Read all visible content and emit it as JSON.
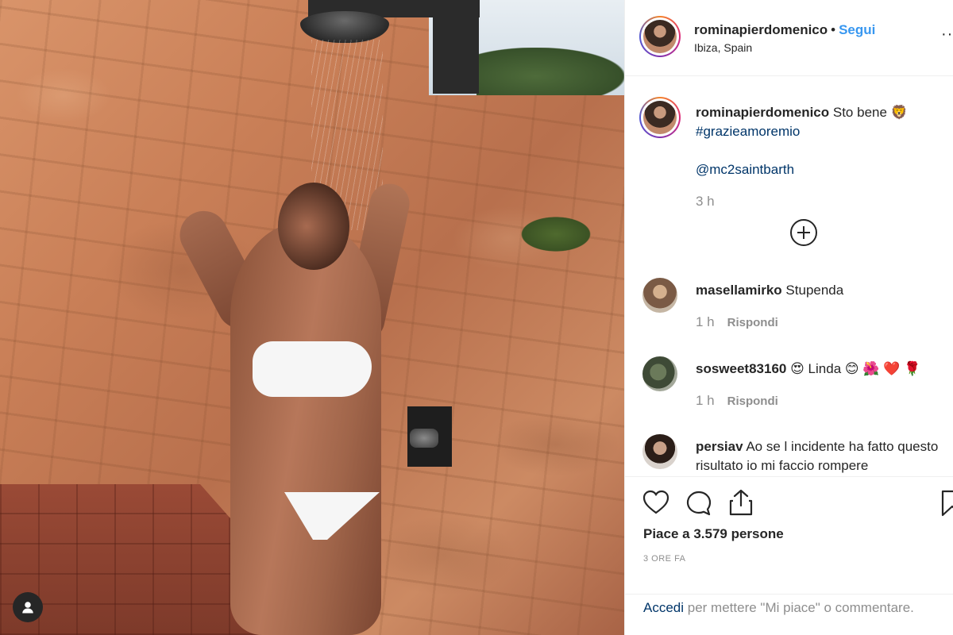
{
  "post": {
    "username": "rominapierdomenico",
    "separator": "•",
    "follow_label": "Segui",
    "location": "Ibiza, Spain",
    "more_label": "···"
  },
  "caption": {
    "username": "rominapierdomenico",
    "text": "Sto bene 🦁",
    "hashtag": "#grazieamoremio",
    "mention": "@mc2saintbarth",
    "time": "3 h"
  },
  "comments": [
    {
      "username": "masellamirko",
      "text": "Stupenda",
      "time": "1 h",
      "reply_label": "Rispondi"
    },
    {
      "username": "sosweet83160",
      "text": "😍 Linda 😊 🌺 ❤️ 🌹",
      "time": "1 h",
      "reply_label": "Rispondi"
    },
    {
      "username": "persiav",
      "text": "Ao se l incidente ha fatto questo risultato io mi faccio rompere"
    }
  ],
  "stats": {
    "likes": "Piace a 3.579 persone",
    "ago": "3 ORE FA"
  },
  "footer": {
    "login": "Accedi",
    "rest": "per mettere \"Mi piace\" o commentare."
  },
  "icons": {
    "like": "heart-icon",
    "comment": "comment-icon",
    "share": "share-icon",
    "save": "bookmark-icon",
    "load_more": "plus-circle-icon",
    "profile": "user-icon"
  },
  "colors": {
    "link_blue": "#3897f0",
    "hashtag_blue": "#003569",
    "muted": "#8e8e8e",
    "text": "#262626"
  }
}
